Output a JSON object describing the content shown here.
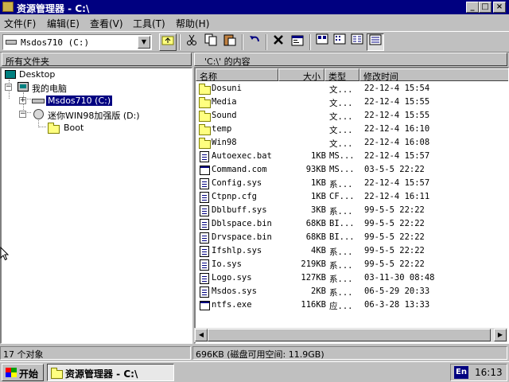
{
  "window": {
    "title": "资源管理器 - C:\\"
  },
  "menu": [
    "文件(F)",
    "编辑(E)",
    "查看(V)",
    "工具(T)",
    "帮助(H)"
  ],
  "toolbar": {
    "address_value": "Msdos710 (C:)",
    "buttons": [
      "up-folder",
      "cut",
      "copy",
      "paste",
      "undo",
      "delete",
      "properties",
      "view-large-icons",
      "view-small-icons",
      "view-list",
      "view-details"
    ]
  },
  "tree": {
    "caption": "所有文件夹",
    "nodes": [
      {
        "label": "Desktop"
      },
      {
        "label": "我的电脑"
      },
      {
        "label": "Msdos710 (C:)",
        "selected": true
      },
      {
        "label": "迷你WIN98加强版 (D:)"
      },
      {
        "label": "Boot"
      }
    ]
  },
  "content": {
    "caption": "'C:\\' 的内容",
    "columns": [
      "名称",
      "大小",
      "类型",
      "修改时间"
    ],
    "rows": [
      {
        "name": "Dosuni",
        "size": "",
        "type": "文...",
        "date": "22-12-4 15:54",
        "icon": "folder"
      },
      {
        "name": "Media",
        "size": "",
        "type": "文...",
        "date": "22-12-4 15:55",
        "icon": "folder"
      },
      {
        "name": "Sound",
        "size": "",
        "type": "文...",
        "date": "22-12-4 15:55",
        "icon": "folder"
      },
      {
        "name": "temp",
        "size": "",
        "type": "文...",
        "date": "22-12-4 16:10",
        "icon": "folder"
      },
      {
        "name": "Win98",
        "size": "",
        "type": "文...",
        "date": "22-12-4 16:08",
        "icon": "folder"
      },
      {
        "name": "Autoexec.bat",
        "size": "1KB",
        "type": "MS...",
        "date": "22-12-4 15:57",
        "icon": "file"
      },
      {
        "name": "Command.com",
        "size": "93KB",
        "type": "MS...",
        "date": "03-5-5 22:22",
        "icon": "exe"
      },
      {
        "name": "Config.sys",
        "size": "1KB",
        "type": "系...",
        "date": "22-12-4 15:57",
        "icon": "file"
      },
      {
        "name": "Ctpnp.cfg",
        "size": "1KB",
        "type": "CF...",
        "date": "22-12-4 16:11",
        "icon": "file"
      },
      {
        "name": "Dblbuff.sys",
        "size": "3KB",
        "type": "系...",
        "date": "99-5-5 22:22",
        "icon": "file"
      },
      {
        "name": "Dblspace.bin",
        "size": "68KB",
        "type": "BI...",
        "date": "99-5-5 22:22",
        "icon": "file"
      },
      {
        "name": "Drvspace.bin",
        "size": "68KB",
        "type": "BI...",
        "date": "99-5-5 22:22",
        "icon": "file"
      },
      {
        "name": "Ifshlp.sys",
        "size": "4KB",
        "type": "系...",
        "date": "99-5-5 22:22",
        "icon": "file"
      },
      {
        "name": "Io.sys",
        "size": "219KB",
        "type": "系...",
        "date": "99-5-5 22:22",
        "icon": "file"
      },
      {
        "name": "Logo.sys",
        "size": "127KB",
        "type": "系...",
        "date": "03-11-30 08:48",
        "icon": "file"
      },
      {
        "name": "Msdos.sys",
        "size": "2KB",
        "type": "系...",
        "date": "06-5-29 20:33",
        "icon": "file"
      },
      {
        "name": "ntfs.exe",
        "size": "116KB",
        "type": "应...",
        "date": "06-3-28 13:33",
        "icon": "exe"
      }
    ]
  },
  "status": {
    "objects": "17 个对象",
    "size": "696KB",
    "free_space": "(磁盘可用空间: 11.9GB)"
  },
  "taskbar": {
    "start_label": "开始",
    "task_label": "资源管理器 - C:\\",
    "ime": "En",
    "clock": "16:13"
  },
  "colors": {
    "title_bar": "#000080",
    "selection": "#000080",
    "face": "#c0c0c0"
  }
}
